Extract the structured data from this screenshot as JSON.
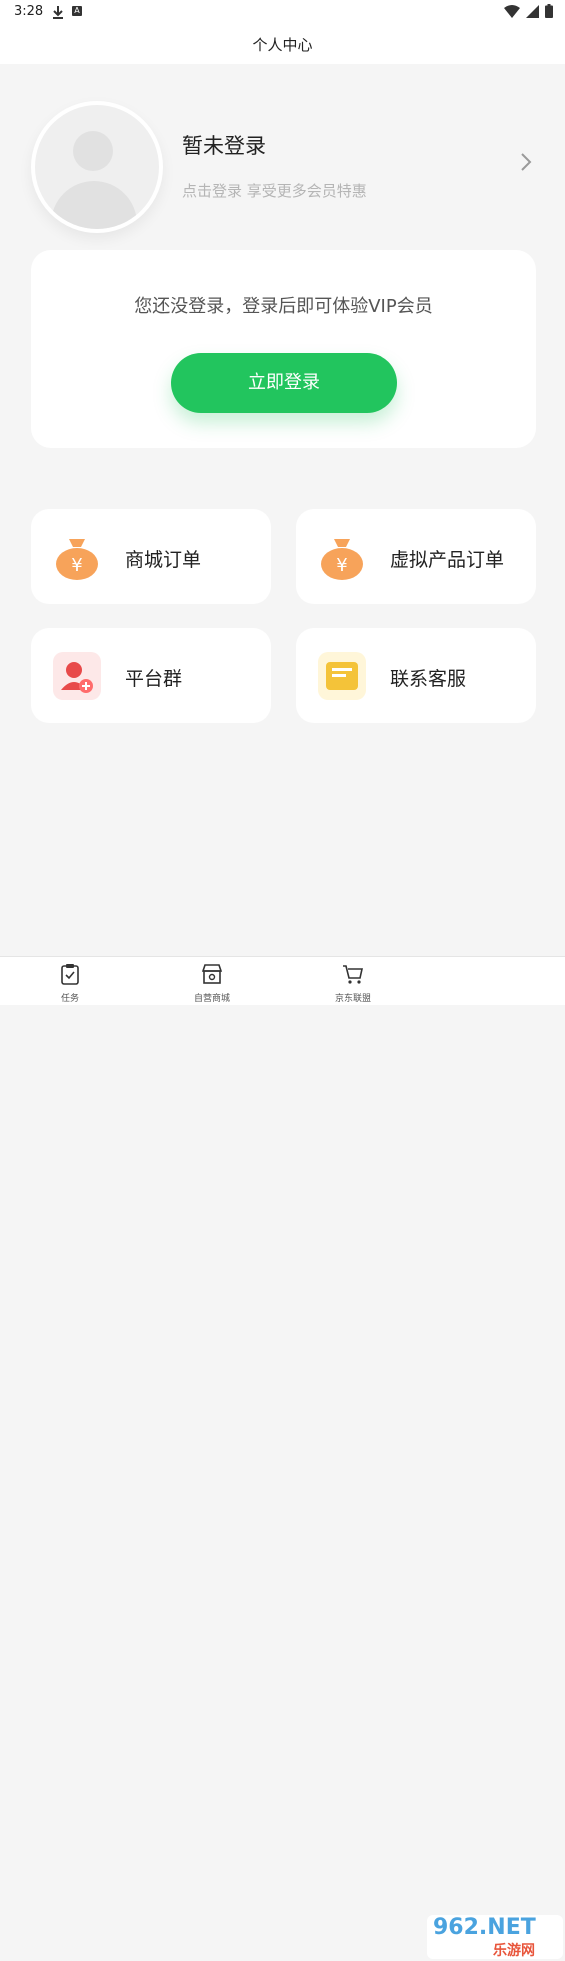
{
  "status_bar": {
    "time": "3:28",
    "a_label": "A"
  },
  "nav": {
    "title": "个人中心"
  },
  "profile": {
    "title": "暂未登录",
    "subtitle": "点击登录 享受更多会员特惠"
  },
  "login_card": {
    "message": "您还没登录，登录后即可体验VIP会员",
    "button_label": "立即登录"
  },
  "menu": [
    {
      "label": "商城订单",
      "icon": "money-bag-icon"
    },
    {
      "label": "虚拟产品订单",
      "icon": "money-bag-icon"
    },
    {
      "label": "平台群",
      "icon": "add-user-icon"
    },
    {
      "label": "联系客服",
      "icon": "mailbox-icon"
    }
  ],
  "tabbar": [
    {
      "label": "任务",
      "icon": "clipboard-icon"
    },
    {
      "label": "自营商城",
      "icon": "store-icon"
    },
    {
      "label": "京东联盟",
      "icon": "cart-icon"
    }
  ],
  "watermark": {
    "text": "962.NET",
    "sub": "乐游网"
  },
  "colors": {
    "accent": "#22c55e",
    "background": "#f5f5f5",
    "bag": "#f7a35a",
    "user_icon": "#e84a4a",
    "mail_icon": "#f4c339"
  }
}
